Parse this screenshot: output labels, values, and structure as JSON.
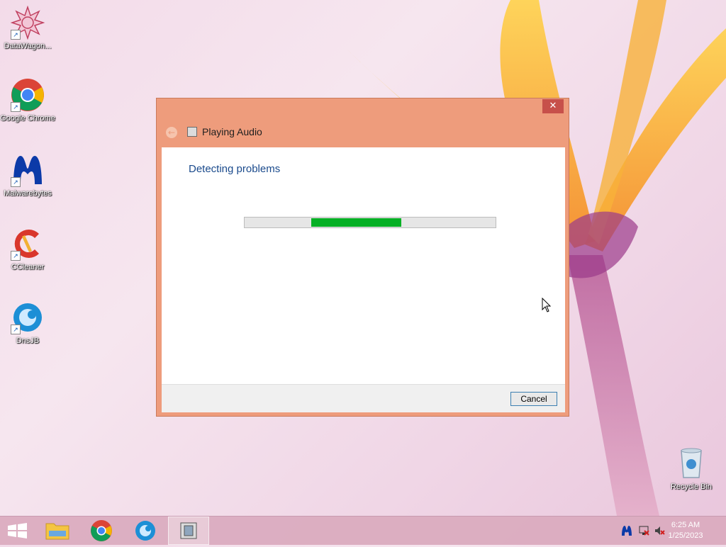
{
  "desktop": {
    "icons": [
      {
        "label": "DataWagon...",
        "icon": "datawagon-icon"
      },
      {
        "label": "Google Chrome",
        "icon": "chrome-icon"
      },
      {
        "label": "Malwarebytes",
        "icon": "malwarebytes-icon"
      },
      {
        "label": "CCleaner",
        "icon": "ccleaner-icon"
      },
      {
        "label": "DnsJB",
        "icon": "dnsjb-icon"
      },
      {
        "label": "Recycle Bin",
        "icon": "recycle-bin-icon"
      }
    ]
  },
  "dialog": {
    "title": "Playing Audio",
    "close_glyph": "✕",
    "back_glyph": "←",
    "heading": "Detecting problems",
    "progress_fill": 0.36,
    "cancel_label": "Cancel"
  },
  "taskbar": {
    "items": [
      "start-button",
      "file-explorer",
      "google-chrome",
      "dnsjb",
      "troubleshooter"
    ],
    "tray": {
      "icons": [
        "malwarebytes-tray-icon",
        "network-icon",
        "volume-muted-icon"
      ],
      "time": "6:25 AM",
      "date": "1/25/2023"
    }
  },
  "colors": {
    "dialog_frame": "#ee9c7c",
    "close_button": "#c7504a",
    "heading_text": "#1a4a8c",
    "progress_green": "#06b025"
  }
}
